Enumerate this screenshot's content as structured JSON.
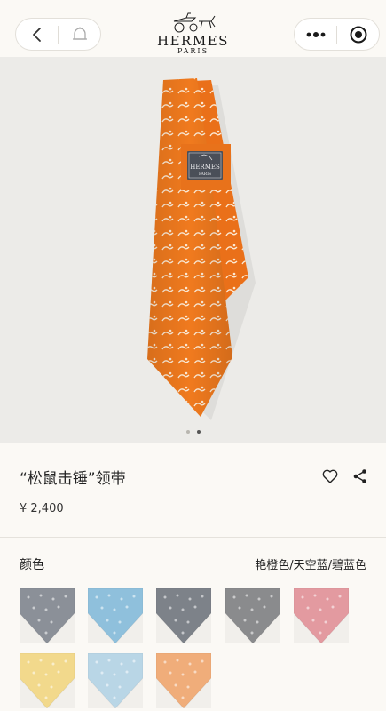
{
  "header": {
    "brand": "HERMES",
    "brand_sub": "PARIS",
    "back_icon": "chevron-left-icon",
    "bell_icon": "bell-icon",
    "more_icon": "more-dots-icon",
    "close_icon": "target-circle-icon"
  },
  "gallery": {
    "tie_color": "#f07a1e",
    "dot_count": 2,
    "active_dot": 2,
    "label_brand": "HERMES",
    "label_sub": "PARIS"
  },
  "product": {
    "title": "“松鼠击锤”领带",
    "price": "¥ 2,400"
  },
  "colors": {
    "label": "颜色",
    "selected": "艳橙色/天空蓝/碧蓝色",
    "swatches": [
      {
        "name": "grey-blue",
        "color": "#8b9098"
      },
      {
        "name": "sky-blue",
        "color": "#8fc0dc"
      },
      {
        "name": "slate-grey",
        "color": "#7d8289"
      },
      {
        "name": "grey",
        "color": "#8a8b8d"
      },
      {
        "name": "rose",
        "color": "#e39aa0"
      },
      {
        "name": "yellow",
        "color": "#f2d98c"
      },
      {
        "name": "light-blue",
        "color": "#b9d6e6"
      },
      {
        "name": "peach",
        "color": "#f0ad7a"
      }
    ]
  }
}
